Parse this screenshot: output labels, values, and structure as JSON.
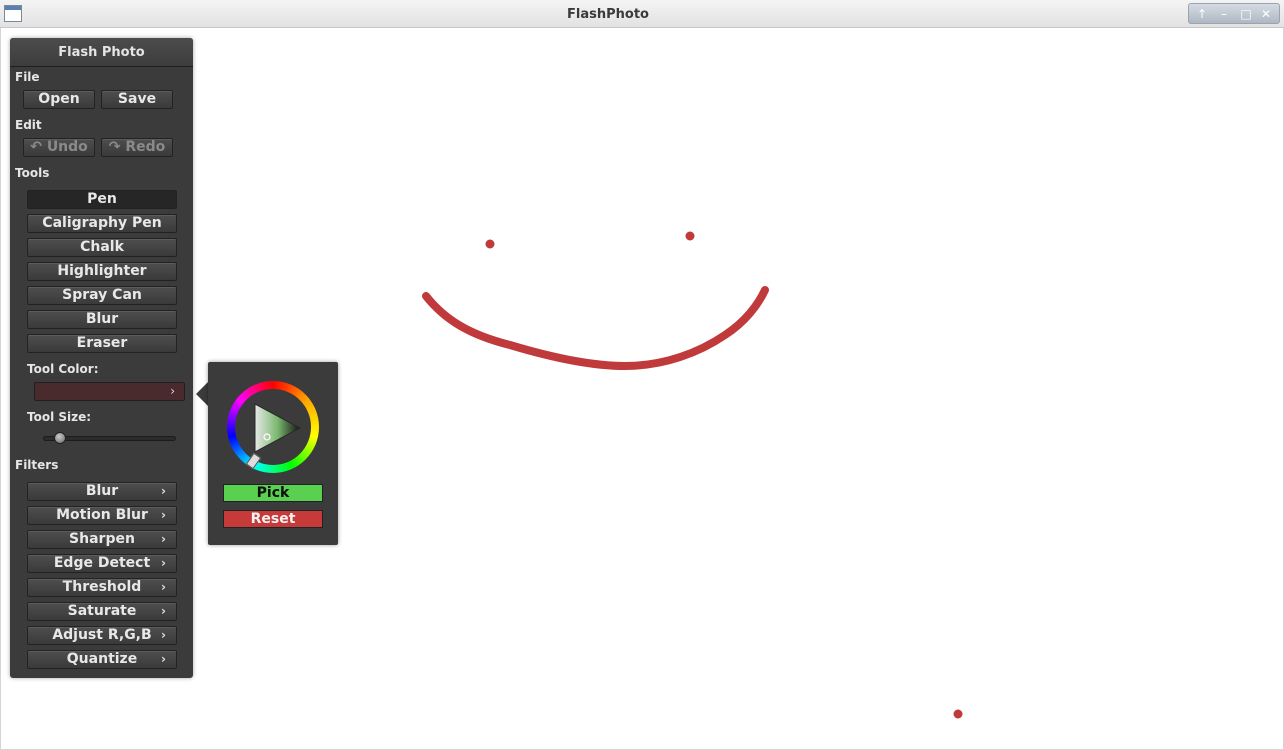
{
  "window": {
    "title": "FlashPhoto",
    "controls": [
      "↑",
      "–",
      "□",
      "✕"
    ]
  },
  "panel": {
    "title": "Flash Photo",
    "file": {
      "label": "File",
      "open": "Open",
      "save": "Save"
    },
    "edit": {
      "label": "Edit",
      "undo": "Undo",
      "redo": "Redo"
    },
    "tools": {
      "label": "Tools",
      "items": [
        "Pen",
        "Caligraphy Pen",
        "Chalk",
        "Highlighter",
        "Spray Can",
        "Blur",
        "Eraser"
      ],
      "active": "Pen"
    },
    "tool_color": {
      "label": "Tool Color:",
      "value": "#4a2b2d"
    },
    "tool_size": {
      "label": "Tool Size:",
      "value": 0.1
    },
    "filters": {
      "label": "Filters",
      "items": [
        "Blur",
        "Motion Blur",
        "Sharpen",
        "Edge Detect",
        "Threshold",
        "Saturate",
        "Adjust R,G,B",
        "Quantize"
      ]
    }
  },
  "color_picker": {
    "pick": "Pick",
    "reset": "Reset"
  },
  "colors": {
    "stroke": "#c0393b",
    "panel": "#3b3b3b",
    "pick": "#5ad050",
    "reset": "#c73a3a"
  }
}
